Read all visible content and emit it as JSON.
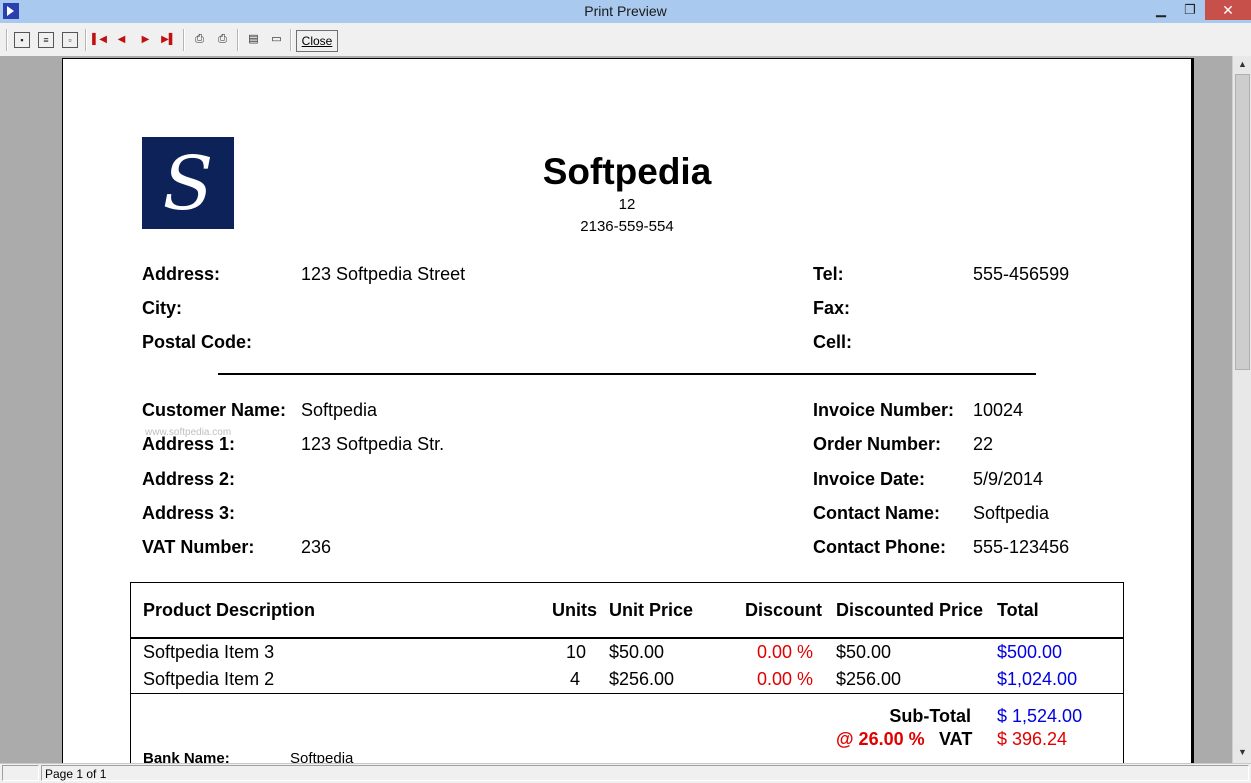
{
  "window": {
    "title": "Print Preview"
  },
  "toolbar": {
    "buttons": [
      {
        "name": "zoom-whole-page-icon",
        "glyph": "▣"
      },
      {
        "name": "zoom-page-width-icon",
        "glyph": "☰"
      },
      {
        "name": "zoom-100-icon",
        "glyph": "⊡"
      },
      {
        "name": "first-page-icon",
        "glyph": "▌◀"
      },
      {
        "name": "previous-page-icon",
        "glyph": "◀"
      },
      {
        "name": "next-page-icon",
        "glyph": "▶"
      },
      {
        "name": "last-page-icon",
        "glyph": "▶▐"
      },
      {
        "name": "print-setup-icon",
        "glyph": "🖶"
      },
      {
        "name": "print-icon",
        "glyph": "⎙"
      },
      {
        "name": "save-icon",
        "glyph": "💾"
      },
      {
        "name": "open-folder-icon",
        "glyph": "📂"
      }
    ],
    "close_label": "Close"
  },
  "report": {
    "company": "Softpedia",
    "logo_letter": "S",
    "line1": "12",
    "line2": "2136-559-554",
    "address_label": "Address:",
    "address_value": "123 Softpedia Street",
    "city_label": "City:",
    "postal_label": "Postal Code:",
    "tel_label": "Tel:",
    "tel_value": "555-456599",
    "fax_label": "Fax:",
    "cell_label": "Cell:",
    "customer_name_label": "Customer Name:",
    "customer_name_value": "Softpedia",
    "address1_label": "Address 1:",
    "address1_value": "123 Softpedia Str.",
    "address2_label": "Address 2:",
    "address3_label": "Address 3:",
    "vat_number_label": "VAT Number:",
    "vat_number_value": "236",
    "invoice_number_label": "Invoice Number:",
    "invoice_number_value": "10024",
    "order_number_label": "Order Number:",
    "order_number_value": "22",
    "invoice_date_label": "Invoice Date:",
    "invoice_date_value": "5/9/2014",
    "contact_name_label": "Contact Name:",
    "contact_name_value": "Softpedia",
    "contact_phone_label": "Contact Phone:",
    "contact_phone_value": "555-123456",
    "watermark": "www.softpedia.com"
  },
  "table": {
    "headers": {
      "product": "Product Description",
      "units": "Units",
      "unit_price": "Unit Price",
      "discount": "Discount",
      "discounted_price": "Discounted Price",
      "total": "Total"
    },
    "rows": [
      {
        "product": "Softpedia Item 3",
        "units": "10",
        "unit_price": "$50.00",
        "discount": "0.00 %",
        "discounted_price": "$50.00",
        "total": "$500.00"
      },
      {
        "product": "Softpedia Item 2",
        "units": "4",
        "unit_price": "$256.00",
        "discount": "0.00 %",
        "discounted_price": "$256.00",
        "total": "$1,024.00"
      }
    ],
    "subtotal_label": "Sub-Total",
    "subtotal_value": "$ 1,524.00",
    "vat_rate": "@ 26.00 %",
    "vat_label": "VAT",
    "vat_value": "$ 396.24",
    "bank_name_label": "Bank Name:",
    "bank_name_value": "Softpedia"
  },
  "status": {
    "page_text": "Page 1 of 1"
  },
  "colors": {
    "accent_red": "#e00000",
    "accent_blue": "#0000e0",
    "logo_bg": "#0e225a"
  }
}
